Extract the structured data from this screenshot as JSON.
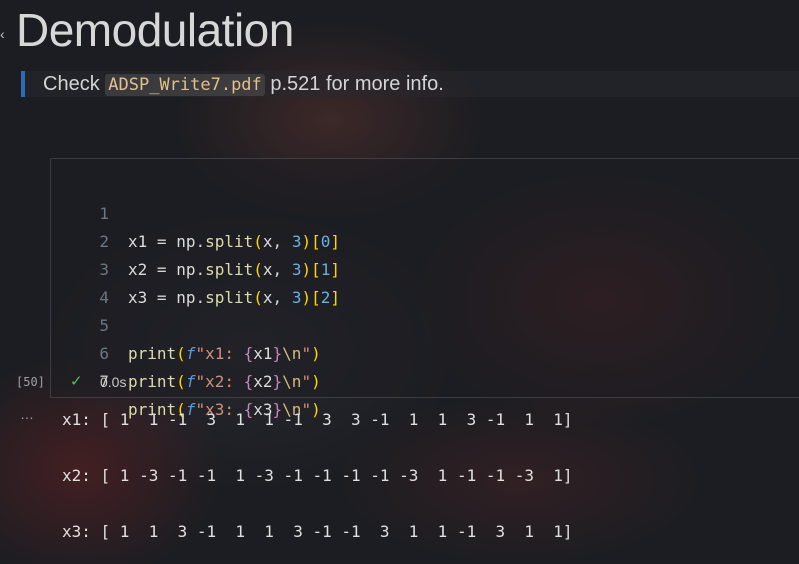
{
  "heading": "Demodulation",
  "note": {
    "prefix": "Check ",
    "code": "ADSP_Write7.pdf",
    "suffix": " p.521 for more info."
  },
  "cell": {
    "lines": [
      {
        "num": "1",
        "var": "x1",
        "idx": "0"
      },
      {
        "num": "2",
        "var": "x2",
        "idx": "1"
      },
      {
        "num": "3",
        "var": "x3",
        "idx": "2"
      },
      {
        "num": "4"
      },
      {
        "num": "5",
        "label": "x1"
      },
      {
        "num": "6",
        "label": "x2"
      },
      {
        "num": "7",
        "label": "x3"
      }
    ],
    "tokens": {
      "np": "np",
      "split": "split",
      "x": "x",
      "three": "3",
      "print": "print",
      "f": "f",
      "newline": "\\n"
    },
    "exec_count": "[50]",
    "exec_time": "0.0s"
  },
  "output": {
    "line1": "x1: [ 1  1 -1  3  1  1 -1  3  3 -1  1  1  3 -1  1  1]",
    "line2": "x2: [ 1 -3 -1 -1  1 -3 -1 -1 -1 -1 -3  1 -1 -1 -3  1]",
    "line3": "x3: [ 1  1  3 -1  1  1  3 -1 -1  3  1  1 -1  3  1  1]"
  },
  "colors": {
    "accent_bar": "#2f6ab6",
    "success": "#4ec25a"
  }
}
